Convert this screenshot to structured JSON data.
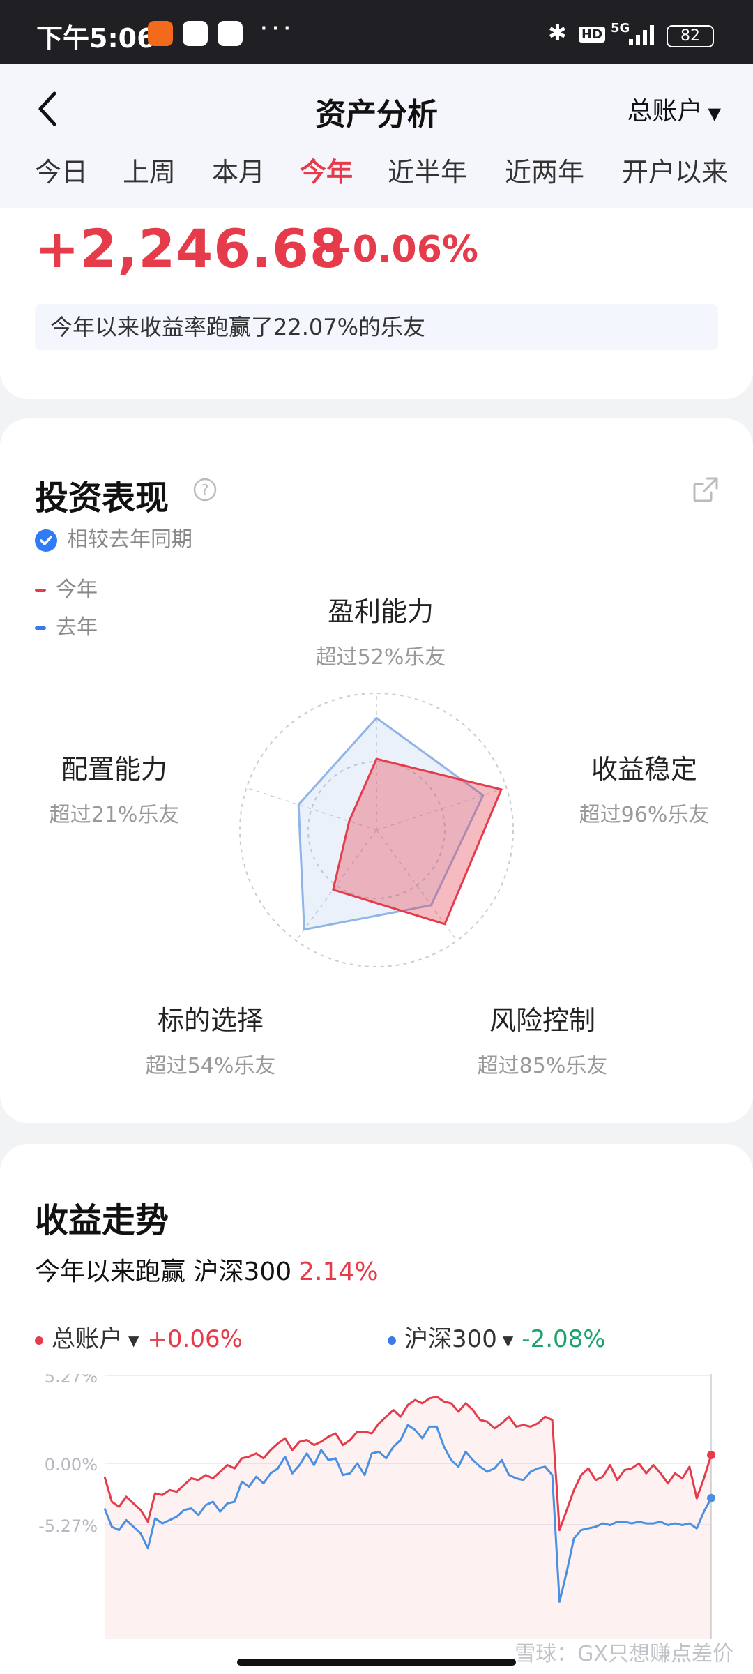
{
  "status_bar": {
    "time": "下午5:06",
    "network": "5G",
    "hd": "HD",
    "battery": "82"
  },
  "header": {
    "title": "资产分析",
    "account": "总账户",
    "tabs": [
      {
        "label": "今日",
        "active": false
      },
      {
        "label": "上周",
        "active": false
      },
      {
        "label": "本月",
        "active": false
      },
      {
        "label": "今年",
        "active": true
      },
      {
        "label": "近半年",
        "active": false
      },
      {
        "label": "近两年",
        "active": false
      },
      {
        "label": "开户以来",
        "active": false
      }
    ]
  },
  "summary": {
    "profit": "+2,246.68",
    "rate": "+0.06%",
    "beat_text": "今年以来收益率跑赢了22.07%的乐友"
  },
  "performance": {
    "title": "投资表现",
    "compare_label": "相较去年同期",
    "legend": {
      "this_year": "今年",
      "last_year": "去年"
    },
    "dimensions": [
      {
        "name": "盈利能力",
        "sub": "超过52%乐友"
      },
      {
        "name": "收益稳定",
        "sub": "超过96%乐友"
      },
      {
        "name": "风险控制",
        "sub": "超过85%乐友"
      },
      {
        "name": "标的选择",
        "sub": "超过54%乐友"
      },
      {
        "name": "配置能力",
        "sub": "超过21%乐友"
      }
    ]
  },
  "trend": {
    "title": "收益走势",
    "beat_prefix": "今年以来跑赢 沪深300",
    "beat_value": "2.14%",
    "series_legend": [
      {
        "name": "总账户",
        "value": "+0.06%"
      },
      {
        "name": "沪深300",
        "value": "-2.08%"
      }
    ],
    "watermark": "雪球：GX只想赚点差价"
  },
  "chart_data": [
    {
      "type": "radar",
      "axes": [
        "盈利能力",
        "收益稳定",
        "风险控制",
        "标的选择",
        "配置能力"
      ],
      "series": [
        {
          "name": "今年",
          "values": [
            0.52,
            0.96,
            0.85,
            0.54,
            0.21
          ]
        },
        {
          "name": "去年",
          "values": [
            0.82,
            0.82,
            0.68,
            0.9,
            0.6
          ]
        }
      ],
      "colors": {
        "今年": "#e63b4a",
        "去年": "#8fb4e8"
      }
    },
    {
      "type": "line",
      "ytick_labels": [
        "5.27%",
        "0.00%",
        "-5.27%"
      ],
      "ylim": [
        -8.5,
        5.27
      ],
      "colors": {
        "总账户": "#e63b4a",
        "沪深300": "#4a90e2"
      },
      "series": [
        {
          "name": "总账户",
          "values": [
            -0.8,
            -2.3,
            -2.6,
            -2.0,
            -2.4,
            -2.8,
            -3.5,
            -1.8,
            -1.9,
            -1.6,
            -1.7,
            -1.3,
            -0.9,
            -1.0,
            -0.7,
            -0.9,
            -0.5,
            -0.1,
            -0.3,
            0.3,
            0.4,
            0.6,
            0.3,
            0.8,
            1.2,
            1.5,
            0.8,
            1.3,
            1.4,
            1.1,
            1.3,
            1.6,
            1.8,
            1.1,
            1.4,
            1.9,
            1.9,
            1.8,
            2.4,
            2.8,
            3.2,
            2.8,
            3.5,
            3.8,
            3.6,
            3.9,
            4.0,
            3.7,
            3.6,
            3.1,
            3.6,
            3.2,
            2.6,
            2.5,
            2.1,
            2.4,
            2.8,
            2.2,
            2.3,
            2.2,
            2.4,
            2.8,
            2.6,
            -4.0,
            -2.8,
            -1.6,
            -0.7,
            -0.3,
            -1.0,
            -0.8,
            -0.1,
            -1.0,
            -0.4,
            -0.3,
            0.0,
            -0.6,
            -0.1,
            -0.6,
            -1.2,
            -0.6,
            -0.9,
            -0.2,
            -2.1,
            -0.9,
            0.5
          ],
          "end_value": "+0.06%"
        },
        {
          "name": "沪深300",
          "values": [
            -2.7,
            -3.8,
            -4.0,
            -3.4,
            -3.8,
            -4.2,
            -5.1,
            -3.3,
            -3.6,
            -3.4,
            -3.2,
            -2.8,
            -2.7,
            -3.1,
            -2.5,
            -2.3,
            -2.9,
            -2.4,
            -2.3,
            -1.1,
            -1.4,
            -0.8,
            -1.2,
            -0.6,
            -0.3,
            0.4,
            -0.6,
            -0.1,
            0.6,
            -0.1,
            0.8,
            0.2,
            0.3,
            -0.7,
            -0.6,
            0.0,
            -0.7,
            0.6,
            0.7,
            0.3,
            1.0,
            1.4,
            2.3,
            2.0,
            1.5,
            2.2,
            2.2,
            1.0,
            0.2,
            -0.2,
            0.7,
            0.2,
            -0.2,
            -0.5,
            -0.3,
            0.2,
            -0.7,
            -0.9,
            -1.0,
            -0.5,
            -0.3,
            -0.2,
            -0.7,
            -8.3,
            -6.5,
            -4.5,
            -4.0,
            -3.9,
            -3.8,
            -3.6,
            -3.7,
            -3.5,
            -3.5,
            -3.6,
            -3.5,
            -3.6,
            -3.6,
            -3.5,
            -3.7,
            -3.6,
            -3.7,
            -3.6,
            -3.9,
            -2.9,
            -2.08
          ],
          "end_value": "-2.08%"
        }
      ]
    }
  ]
}
